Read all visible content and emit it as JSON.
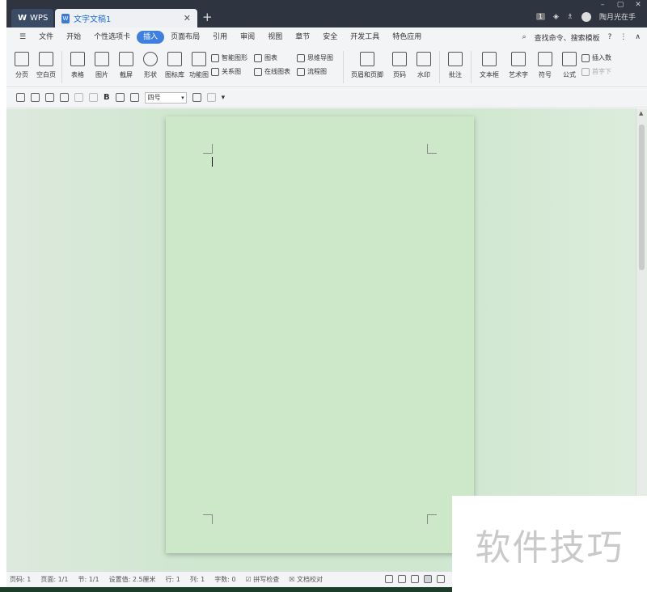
{
  "app": {
    "brand_label": "WPS",
    "doc_tab_title": "文字文稿1",
    "user_name": "陶月光在手",
    "page_badge": "1"
  },
  "menu": {
    "file_label": "文件",
    "items": [
      "开始",
      "个性选项卡",
      "插入",
      "页面布局",
      "引用",
      "审阅",
      "视图",
      "章节",
      "安全",
      "开发工具",
      "特色应用"
    ],
    "active_item": "插入",
    "search_label": "查找命令、搜索模板"
  },
  "ribbon": {
    "page_break": "分页",
    "blank_page": "空白页",
    "table": "表格",
    "picture": "图片",
    "screenshot": "截屏",
    "shape": "形状",
    "icon_lib": "图标库",
    "function_chart": "功能图",
    "smart_shape": "智能图形",
    "chart": "图表",
    "mindmap": "思维导图",
    "relation": "关系图",
    "online_chart": "在线图表",
    "flowchart": "流程图",
    "header_footer": "页眉和页脚",
    "page_number": "页码",
    "watermark_btn": "水印",
    "comment": "批注",
    "textbox": "文本框",
    "wordart": "艺术字",
    "symbol": "符号",
    "formula": "公式",
    "insert_num": "插入数",
    "first_char": "首字下"
  },
  "quickbar": {
    "bold": "B",
    "font_size": "四号"
  },
  "status": {
    "page_no": "页码: 1",
    "pages": "页面: 1/1",
    "section": "节: 1/1",
    "setting": "设置值: 2.5厘米",
    "row": "行: 1",
    "col": "列: 1",
    "word_count": "字数: 0",
    "spell_check": "拼写检查",
    "doc_proof": "文档校对"
  },
  "watermark_text": "软件技巧"
}
